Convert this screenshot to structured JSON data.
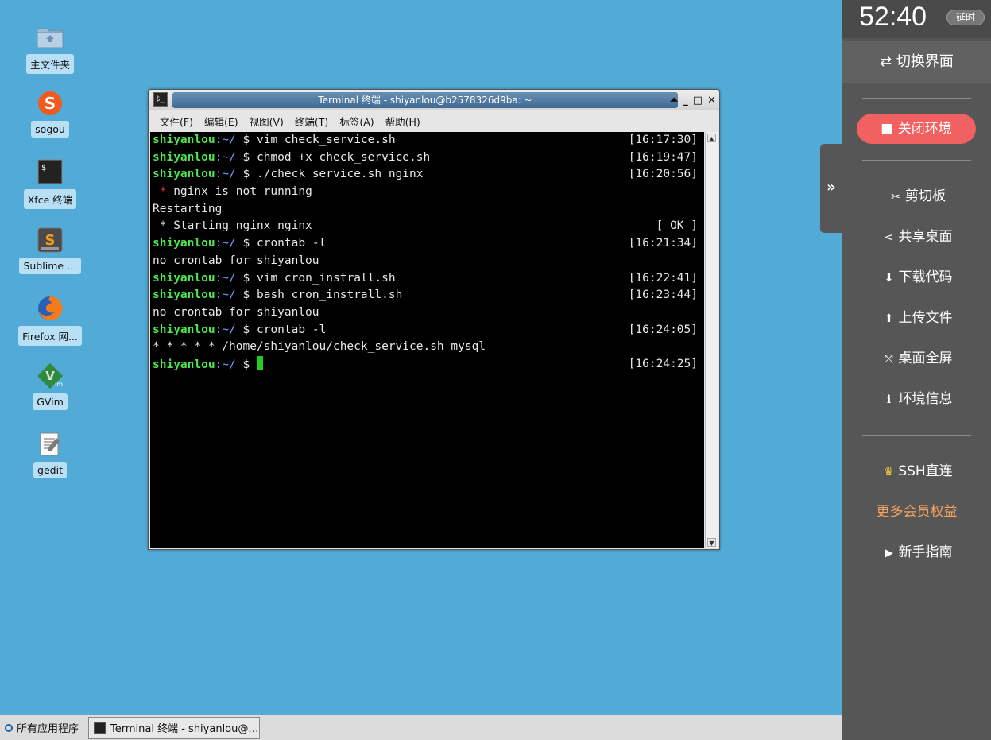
{
  "desktop": {
    "icons": [
      {
        "label": "主文件夹",
        "icon": "home-folder-icon"
      },
      {
        "label": "sogou",
        "icon": "sogou-icon"
      },
      {
        "label": "Xfce 终端",
        "icon": "terminal-icon"
      },
      {
        "label": "Sublime …",
        "icon": "sublime-icon"
      },
      {
        "label": "Firefox 网...",
        "icon": "firefox-icon"
      },
      {
        "label": "GVim",
        "icon": "gvim-icon"
      },
      {
        "label": "gedit",
        "icon": "gedit-icon"
      }
    ]
  },
  "terminal": {
    "title": "Terminal 终端 - shiyanlou@b2578326d9ba: ~",
    "menu": [
      "文件(F)",
      "编辑(E)",
      "视图(V)",
      "终端(T)",
      "标签(A)",
      "帮助(H)"
    ],
    "prompt_user": "shiyanlou",
    "prompt_path": ":~/",
    "prompt_sign": " $ ",
    "lines": [
      {
        "type": "cmd",
        "text": "vim check_service.sh",
        "time": "[16:17:30]"
      },
      {
        "type": "cmd",
        "text": "chmod +x check_service.sh",
        "time": "[16:19:47]"
      },
      {
        "type": "cmd",
        "text": "./check_service.sh nginx",
        "time": "[16:20:56]"
      },
      {
        "type": "err",
        "bullet": " * ",
        "text": "nginx is not running",
        "time": ""
      },
      {
        "type": "out",
        "text": "Restarting",
        "time": ""
      },
      {
        "type": "out",
        "text": " * Starting nginx nginx",
        "time": "[ OK ]"
      },
      {
        "type": "cmd",
        "text": "crontab -l",
        "time": "[16:21:34]"
      },
      {
        "type": "out",
        "text": "no crontab for shiyanlou",
        "time": ""
      },
      {
        "type": "cmd",
        "text": "vim cron_instrall.sh",
        "time": "[16:22:41]"
      },
      {
        "type": "cmd",
        "text": "bash cron_instrall.sh",
        "time": "[16:23:44]"
      },
      {
        "type": "out",
        "text": "no crontab for shiyanlou",
        "time": ""
      },
      {
        "type": "cmd",
        "text": "crontab -l",
        "time": "[16:24:05]"
      },
      {
        "type": "out",
        "text": "* * * * * /home/shiyanlou/check_service.sh mysql",
        "time": ""
      },
      {
        "type": "cursor",
        "text": "",
        "time": "[16:24:25]"
      }
    ]
  },
  "taskbar": {
    "apps_label": "所有应用程序",
    "task_label": "Terminal 终端 - shiyanlou@…"
  },
  "panel": {
    "timer": "52:40",
    "extend": "延时",
    "switch_label": "切换界面",
    "close_env": "关闭环境",
    "collapse_glyph": "»",
    "items": [
      {
        "label": "剪切板",
        "icon": "scissors-icon"
      },
      {
        "label": "共享桌面",
        "icon": "share-icon"
      },
      {
        "label": "下载代码",
        "icon": "download-icon"
      },
      {
        "label": "上传文件",
        "icon": "upload-icon"
      },
      {
        "label": "桌面全屏",
        "icon": "fullscreen-icon"
      },
      {
        "label": "环境信息",
        "icon": "info-icon"
      }
    ],
    "ssh": "SSH直连",
    "vip": "更多会员权益",
    "guide": "新手指南"
  },
  "colors": {
    "desktop": "#52aad6",
    "panel": "#565656",
    "close_button": "#f26161",
    "vip_text": "#f5a25c",
    "prompt_user": "#4be74b",
    "prompt_path": "#7a9cff"
  }
}
